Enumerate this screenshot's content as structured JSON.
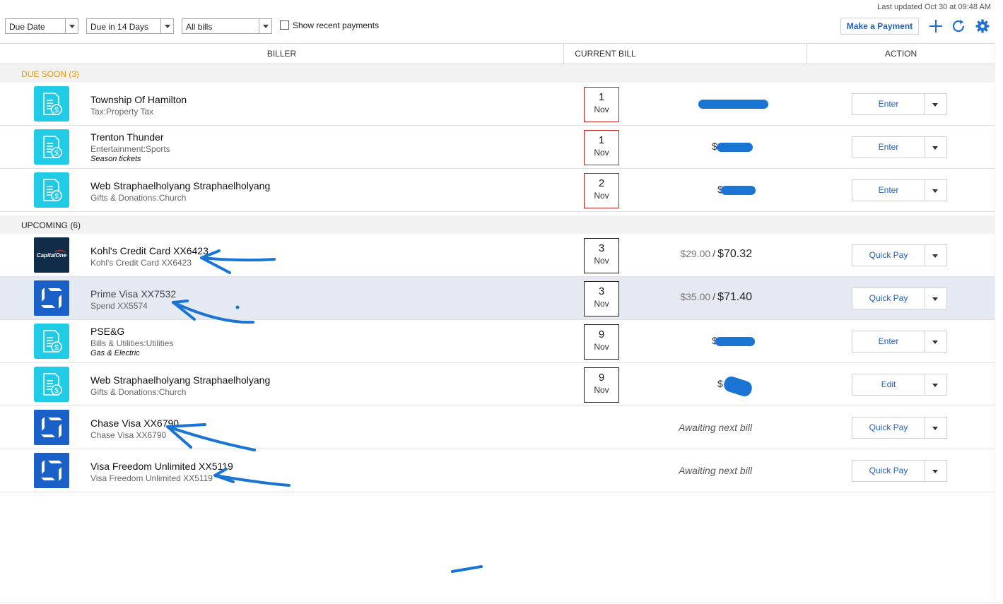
{
  "last_updated": "Last updated Oct 30 at 09:48 AM",
  "filters": {
    "sort": "Due Date",
    "range": "Due in 14 Days",
    "bill_type": "All bills",
    "show_recent_label": "Show recent payments"
  },
  "toolbar": {
    "make_payment_label": "Make a Payment",
    "add_icon": "plus-icon",
    "refresh_icon": "refresh-icon",
    "settings_icon": "gear-icon"
  },
  "columns": {
    "biller": "BILLER",
    "current_bill": "CURRENT BILL",
    "action": "ACTION"
  },
  "colors": {
    "accent": "#1f5fbf",
    "due_soon": "#e8960c",
    "overdue_border": "#cc2222",
    "generic_logo": "#20cbe6",
    "chase_logo": "#1960c8",
    "capital_one_logo": "#0f2d49"
  },
  "sections": {
    "due_soon": {
      "label": "DUE SOON (3)",
      "rows": [
        {
          "name": "Township Of Hamilton",
          "category": "Tax:Property Tax",
          "note": "",
          "day": "1",
          "month": "Nov",
          "amount_display": "$",
          "action": "Enter",
          "logo": "bill-document-icon"
        },
        {
          "name": "Trenton Thunder",
          "category": "Entertainment:Sports",
          "note": "Season tickets",
          "day": "1",
          "month": "Nov",
          "amount_display": "$",
          "action": "Enter",
          "logo": "bill-document-icon"
        },
        {
          "name": "Web Straphaelholyang Straphaelholyang",
          "category": "Gifts & Donations:Church",
          "note": "",
          "day": "2",
          "month": "Nov",
          "amount_display": "$",
          "action": "Enter",
          "logo": "bill-document-icon"
        }
      ]
    },
    "upcoming": {
      "label": "UPCOMING (6)",
      "rows": [
        {
          "name": "Kohl's Credit Card XX6423",
          "category": "Kohl's Credit Card XX6423",
          "note": "",
          "day": "3",
          "month": "Nov",
          "min_amount": "$29.00",
          "amount": "$70.32",
          "action": "Quick Pay",
          "logo": "capital-one-logo",
          "logo_text": "CapitalOne"
        },
        {
          "name": "Prime Visa XX7532",
          "category": "Spend XX5574",
          "note": "",
          "day": "3",
          "month": "Nov",
          "min_amount": "$35.00",
          "amount": "$71.40",
          "action": "Quick Pay",
          "logo": "chase-logo"
        },
        {
          "name": "PSE&G",
          "category": "Bills & Utilities:Utilities",
          "note": "Gas & Electric",
          "day": "9",
          "month": "Nov",
          "amount_display": "$",
          "action": "Enter",
          "logo": "bill-document-icon"
        },
        {
          "name": "Web Straphaelholyang Straphaelholyang",
          "category": "Gifts & Donations:Church",
          "note": "",
          "day": "9",
          "month": "Nov",
          "amount_display": "$",
          "action": "Edit",
          "logo": "bill-document-icon"
        },
        {
          "name": "Chase Visa XX6790",
          "category": "Chase Visa XX6790",
          "note": "",
          "status": "Awaiting next bill",
          "action": "Quick Pay",
          "logo": "chase-logo"
        },
        {
          "name": "Visa Freedom Unlimited XX5119",
          "category": "Visa Freedom Unlimited XX5119",
          "note": "",
          "status": "Awaiting next bill",
          "action": "Quick Pay",
          "logo": "chase-logo"
        }
      ]
    }
  },
  "separator": "/"
}
